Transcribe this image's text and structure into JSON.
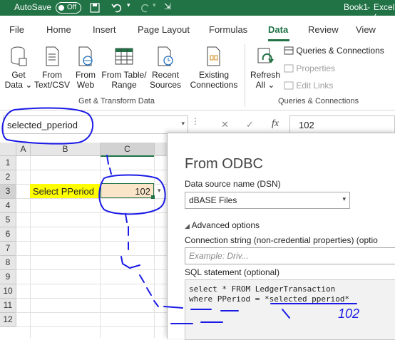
{
  "titlebar": {
    "autosave": "AutoSave",
    "toggle": "Off",
    "doc": "Book1",
    "app": "Excel (",
    "sep": "-"
  },
  "tabs": [
    "File",
    "Home",
    "Insert",
    "Page Layout",
    "Formulas",
    "Data",
    "Review",
    "View"
  ],
  "ribbon": {
    "get_data": [
      "Get",
      "Data"
    ],
    "from_text": [
      "From",
      "Text/CSV"
    ],
    "from_web": [
      "From",
      "Web"
    ],
    "from_table": [
      "From Table/",
      "Range"
    ],
    "recent": [
      "Recent",
      "Sources"
    ],
    "existing": [
      "Existing",
      "Connections"
    ],
    "refresh": [
      "Refresh",
      "All"
    ],
    "queries_connections": "Queries & Connections",
    "properties": "Properties",
    "edit_links": "Edit Links",
    "group1": "Get & Transform Data",
    "group2": "Queries & Connections"
  },
  "namebox": "selected_pperiod",
  "formula": {
    "value": "102",
    "fx": "fx"
  },
  "grid": {
    "columns": [
      "A",
      "B",
      "C"
    ],
    "rows": [
      "1",
      "2",
      "3",
      "4",
      "5",
      "6",
      "7",
      "8",
      "9",
      "10",
      "11",
      "12"
    ],
    "b3": "Select PPeriod",
    "c3": "102"
  },
  "dialog": {
    "title": "From ODBC",
    "dsn_label": "Data source name (DSN)",
    "dsn_value": "dBASE Files",
    "advanced": "Advanced options",
    "conn_label": "Connection string (non-credential properties) (optio",
    "conn_placeholder": "Example: Driv...",
    "sql_label": "SQL statement (optional)",
    "sql_line1": "select * FROM LedgerTransaction",
    "sql_line2": "where PPeriod = *selected_pperiod*"
  },
  "annotation": {
    "handwritten": "102"
  },
  "colors": {
    "excel_green": "#217346",
    "highlight_yellow": "#ffff00",
    "ink_blue": "#1a1ae6"
  }
}
